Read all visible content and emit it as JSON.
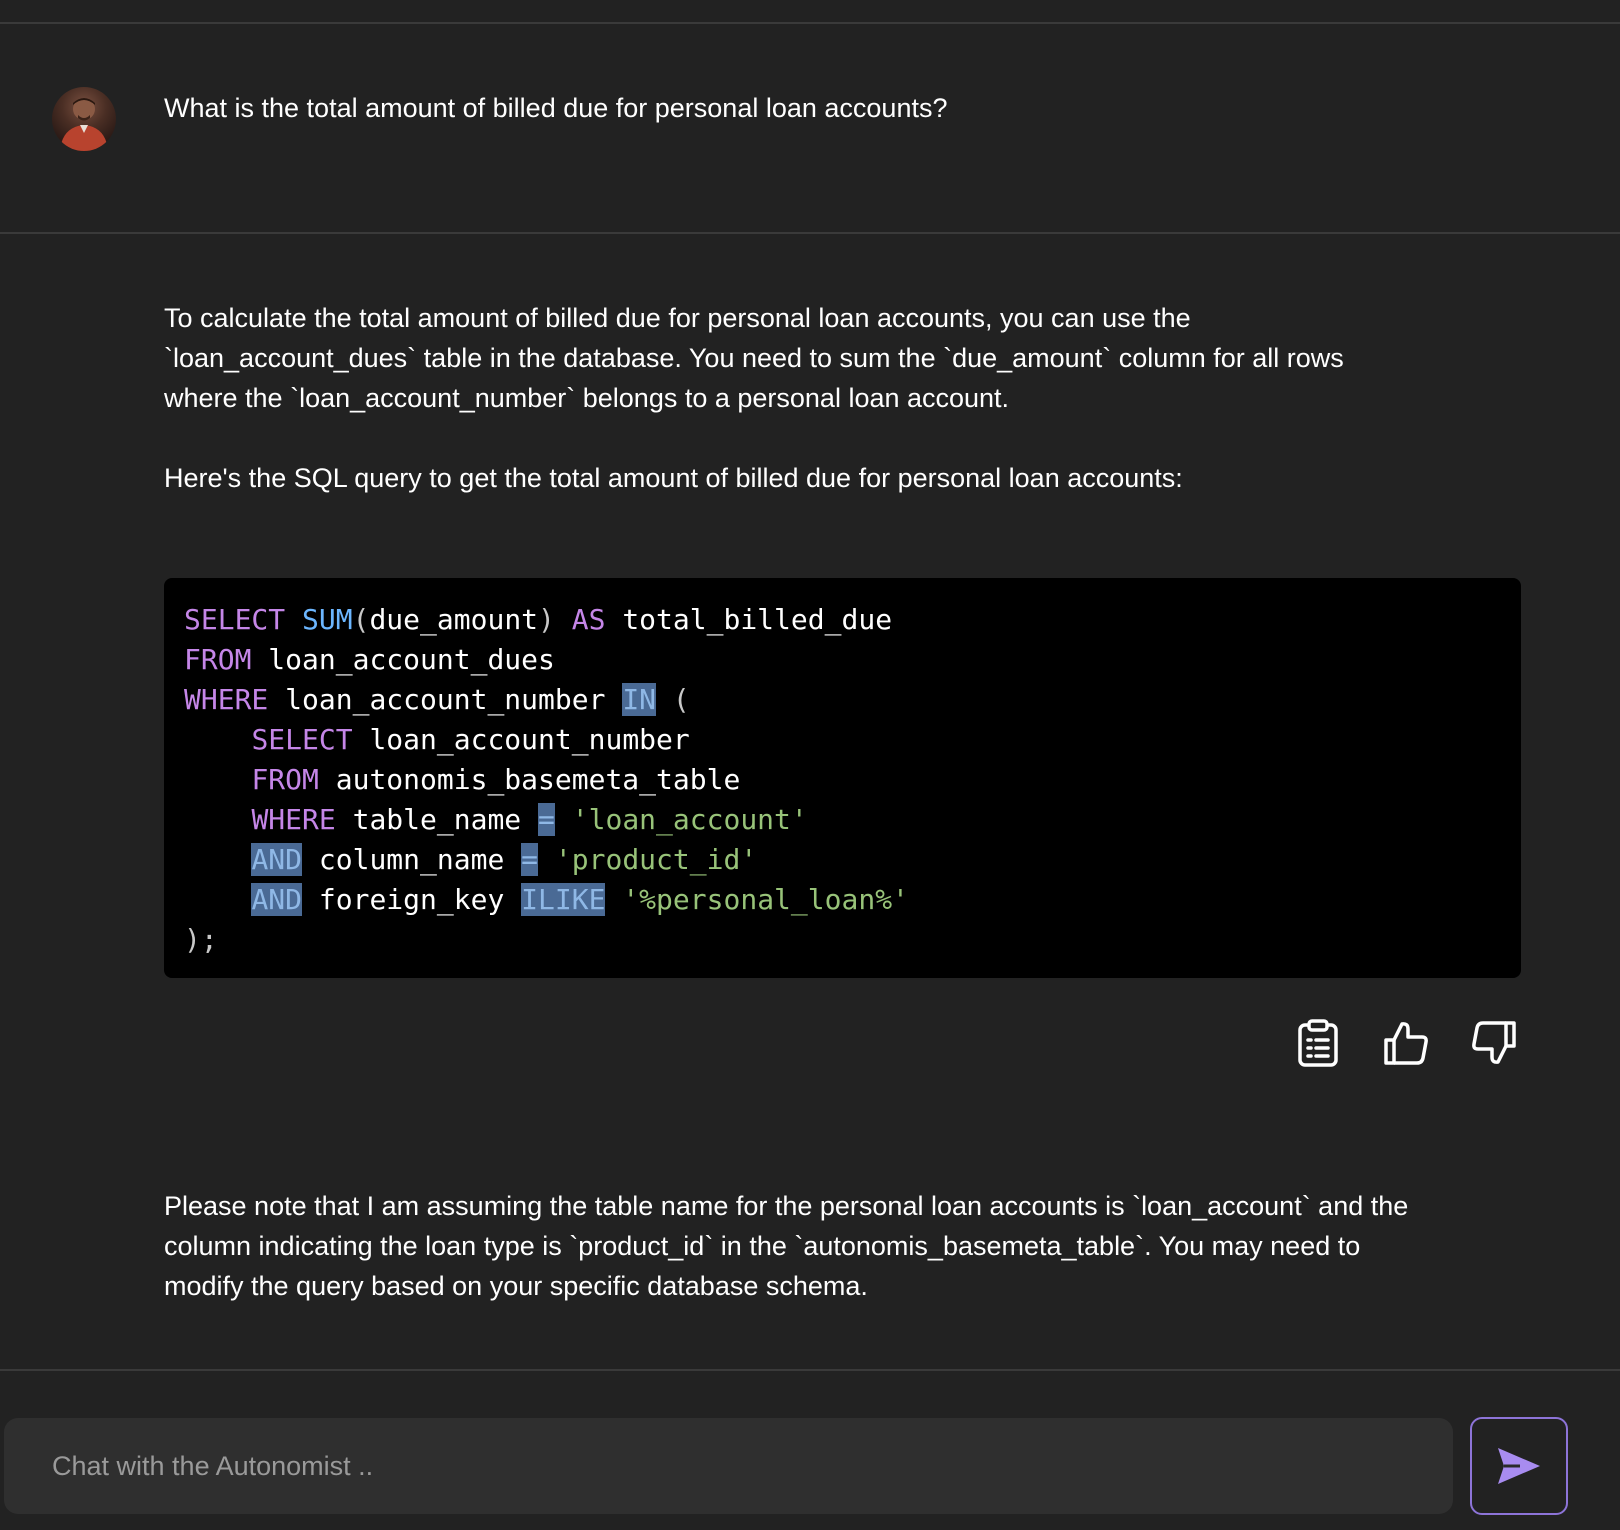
{
  "user_message": {
    "text": "What is the total amount of billed due for personal loan accounts?"
  },
  "assistant_message": {
    "paragraph_1_line_1": "To calculate the total amount of billed due for personal loan accounts, you can use the",
    "paragraph_1_line_2": "`loan_account_dues` table in the database. You need to sum the `due_amount` column for all rows",
    "paragraph_1_line_3": "where the `loan_account_number` belongs to a personal loan account.",
    "paragraph_2": "Here's the SQL query to get the total amount of billed due for personal loan accounts:",
    "code_lines": [
      "SELECT SUM(due_amount) AS total_billed_due",
      "FROM loan_account_dues",
      "WHERE loan_account_number IN (",
      "    SELECT loan_account_number",
      "    FROM autonomis_basemeta_table",
      "    WHERE table_name = 'loan_account'",
      "    AND column_name = 'product_id'",
      "    AND foreign_key ILIKE '%personal_loan%'",
      ");"
    ],
    "paragraph_3_line_1": "Please note that I am assuming the table name for the personal loan accounts is `loan_account` and the",
    "paragraph_3_line_2": "column indicating the loan type is `product_id` in the `autonomis_basemeta_table`. You may need to",
    "paragraph_3_line_3": "modify the query based on your specific database schema."
  },
  "actions": {
    "copy_icon": "clipboard-icon",
    "like_icon": "thumbs-up-icon",
    "dislike_icon": "thumbs-down-icon"
  },
  "composer": {
    "placeholder": "Chat with the Autonomist ..",
    "value": "",
    "send_icon": "send-icon"
  },
  "colors": {
    "background": "#222222",
    "code_background": "#000000",
    "keyword": "#c586e8",
    "function": "#6cb6ff",
    "string": "#98c379",
    "accent": "#8d74d8"
  }
}
